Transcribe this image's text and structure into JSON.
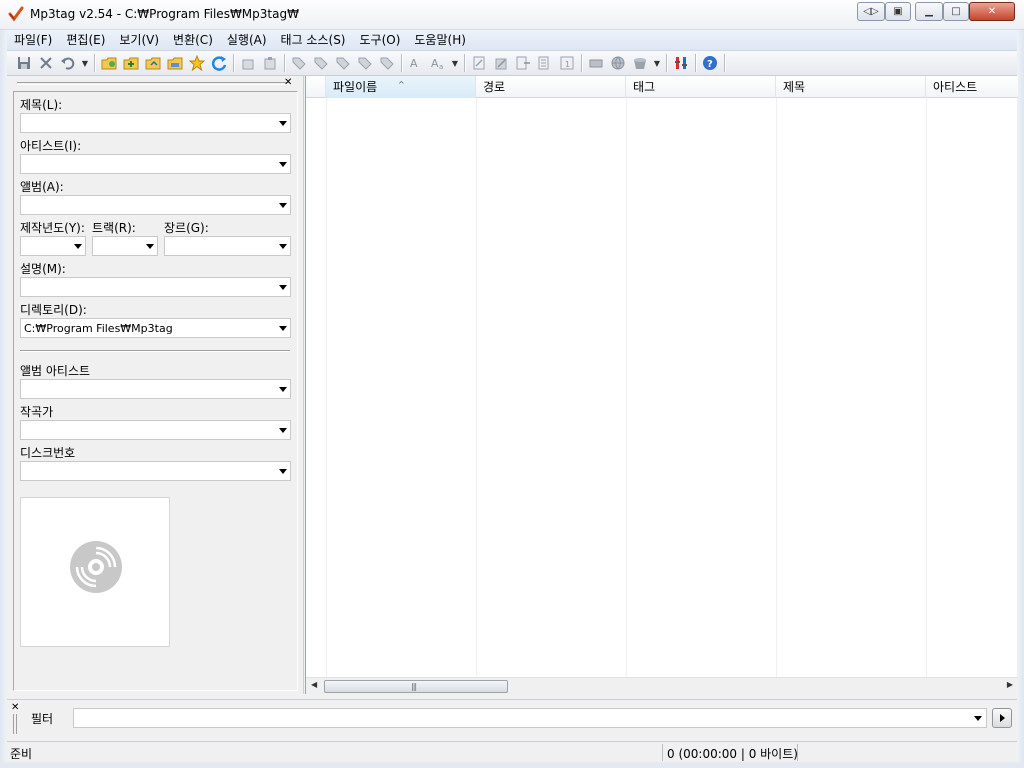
{
  "window": {
    "title": "Mp3tag v2.54  -  C:₩Program Files₩Mp3tag₩",
    "controls": [
      "restore-left",
      "restore-right",
      "minimize",
      "maximize",
      "close"
    ]
  },
  "menu": [
    "파일(F)",
    "편집(E)",
    "보기(V)",
    "변환(C)",
    "실행(A)",
    "태그 소스(S)",
    "도구(O)",
    "도움말(H)"
  ],
  "toolbar": {
    "icons": [
      "save-icon",
      "remove-tag-icon",
      "undo-icon",
      "change-directory-icon",
      "add-directory-icon",
      "open-folder-icon",
      "favorites-icon",
      "refresh-icon",
      "cut-tag-icon",
      "paste-tag-icon",
      "tag-source-icons",
      "convert-icons",
      "export-icon",
      "options-icon",
      "help-icon"
    ]
  },
  "tag_panel": {
    "fields": {
      "title": "제목(L):",
      "artist": "아티스트(I):",
      "album": "앨범(A):",
      "year": "제작년도(Y):",
      "track": "트랙(R):",
      "genre": "장르(G):",
      "comment": "설명(M):",
      "directory": "디렉토리(D):",
      "album_artist": "앨범 아티스트",
      "composer": "작곡가",
      "disc_number": "디스크번호"
    },
    "directory_value": "C:₩Program Files₩Mp3tag"
  },
  "file_list": {
    "columns": [
      "파일이름",
      "경로",
      "태그",
      "제목",
      "아티스트"
    ],
    "sorted_column": "파일이름"
  },
  "filter": {
    "label": "필터",
    "value": ""
  },
  "status": {
    "text": "준비",
    "count": "0 (00:00:00 | 0 바이트)"
  }
}
